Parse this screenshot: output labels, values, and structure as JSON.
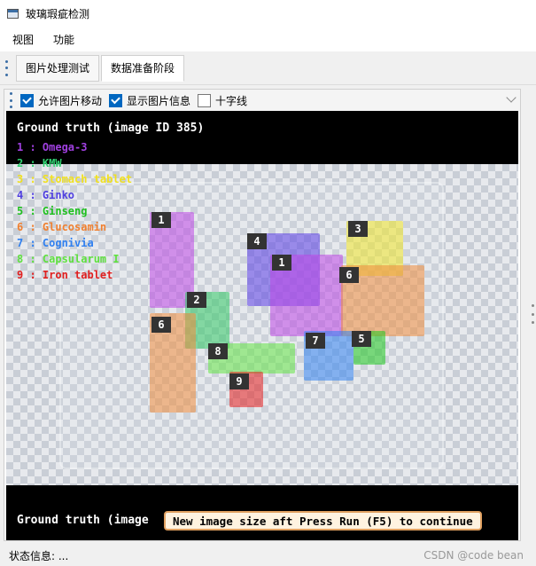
{
  "window": {
    "title": "玻璃瑕疵检测",
    "icon": "window-icon"
  },
  "menu": {
    "items": [
      "视图",
      "功能"
    ]
  },
  "tabs": {
    "items": [
      "图片处理测试",
      "数据准备阶段"
    ],
    "active": 1
  },
  "toolbar": {
    "allow_move_label": "允许图片移动",
    "allow_move_checked": true,
    "show_info_label": "显示图片信息",
    "show_info_checked": true,
    "crosshair_label": "十字线",
    "crosshair_checked": false
  },
  "viewer": {
    "overlay_title": "Ground truth (image ID 385)",
    "legend": [
      {
        "text": "1 : Omega-3",
        "color": "#a040e0"
      },
      {
        "text": "2 : KMW",
        "color": "#30d070"
      },
      {
        "text": "3 : Stomach tablet",
        "color": "#f0e020"
      },
      {
        "text": "4 : Ginko",
        "color": "#5040e0"
      },
      {
        "text": "5 : Ginseng",
        "color": "#20c020"
      },
      {
        "text": "6 : Glucosamin",
        "color": "#f08030"
      },
      {
        "text": "7 : Cognivia",
        "color": "#3080f0"
      },
      {
        "text": "8 : Capsularum I",
        "color": "#60e040"
      },
      {
        "text": "9 : Iron tablet",
        "color": "#e02020"
      }
    ],
    "boxes": [
      {
        "label": "1",
        "color": "#b040e0"
      },
      {
        "label": "4",
        "color": "#5040e0"
      },
      {
        "label": "1",
        "color": "#b040e0"
      },
      {
        "label": "3",
        "color": "#f0e020"
      },
      {
        "label": "6",
        "color": "#f08030"
      },
      {
        "label": "2",
        "color": "#30c060"
      },
      {
        "label": "6",
        "color": "#f08030"
      },
      {
        "label": "8",
        "color": "#60e040"
      },
      {
        "label": "7",
        "color": "#3080f0"
      },
      {
        "label": "5",
        "color": "#20c020"
      },
      {
        "label": "9",
        "color": "#e02020"
      }
    ],
    "bottom_text": "Ground truth (image",
    "toast": "New image size aft Press Run (F5) to continue"
  },
  "status": {
    "text": "状态信息: ...",
    "watermark": "CSDN @code bean"
  }
}
